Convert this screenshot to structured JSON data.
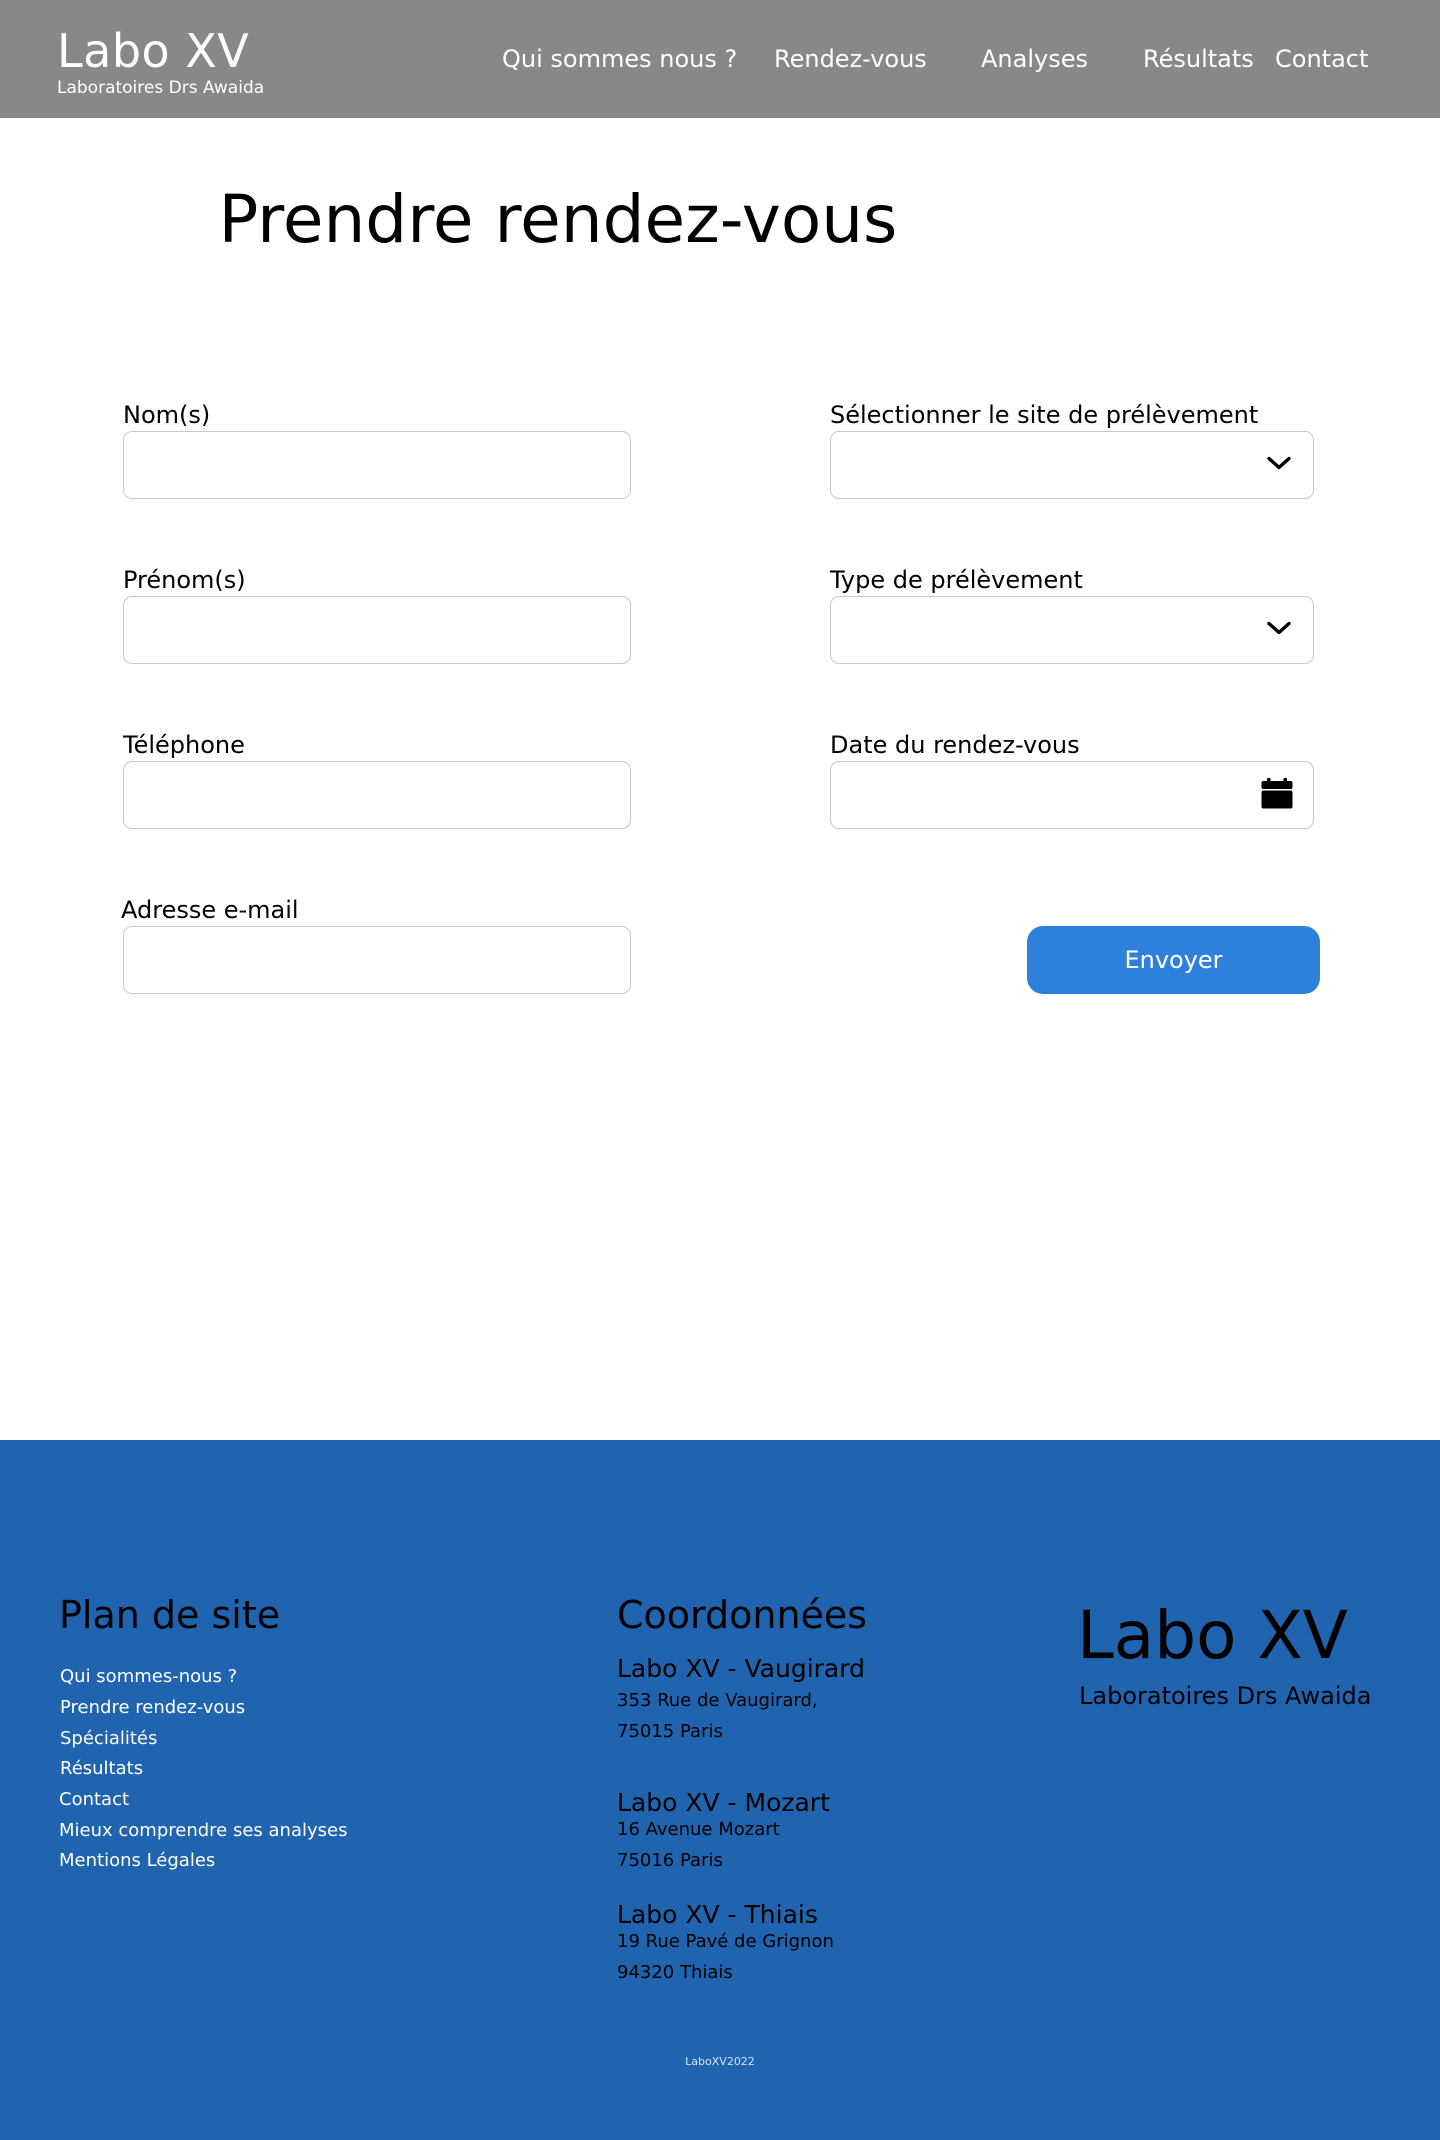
{
  "header": {
    "brand_title": "Labo XV",
    "brand_subtitle": "Laboratoires Drs Awaida",
    "nav": [
      {
        "label": "Qui sommes nous ?"
      },
      {
        "label": "Rendez-vous"
      },
      {
        "label": "Analyses"
      },
      {
        "label": "Résultats"
      },
      {
        "label": "Contact"
      }
    ],
    "background_color": "#888888"
  },
  "main": {
    "title": "Prendre rendez-vous",
    "form": {
      "last_name": {
        "label": "Nom(s)",
        "value": ""
      },
      "first_name": {
        "label": "Prénom(s)",
        "value": ""
      },
      "phone": {
        "label": "Téléphone",
        "value": ""
      },
      "email": {
        "label": "Adresse e-mail",
        "value": ""
      },
      "site": {
        "label": "Sélectionner le site de prélèvement",
        "value": "",
        "icon": "chevron-down-icon"
      },
      "type": {
        "label": "Type de prélèvement",
        "value": "",
        "icon": "chevron-down-icon"
      },
      "date": {
        "label": "Date du rendez-vous",
        "value": "",
        "icon": "calendar-icon"
      },
      "submit_label": "Envoyer",
      "submit_color": "#2f80dd"
    }
  },
  "footer": {
    "background_color": "#2063ae",
    "sitemap": {
      "heading": "Plan de site",
      "links": [
        "Qui sommes-nous ?",
        "Prendre rendez-vous",
        "Spécialités",
        "Résultats",
        "Contact",
        "Mieux comprendre ses analyses",
        "Mentions Légales"
      ]
    },
    "contact": {
      "heading": "Coordonnées",
      "sites": [
        {
          "name": "Labo XV - Vaugirard",
          "line1": "353 Rue de Vaugirard,",
          "line2": "75015 Paris"
        },
        {
          "name": "Labo XV - Mozart",
          "line1": "16 Avenue Mozart",
          "line2": "75016 Paris"
        },
        {
          "name": "Labo XV - Thiais",
          "line1": "19 Rue Pavé de Grignon",
          "line2": "94320 Thiais"
        }
      ]
    },
    "brand_title": "Labo XV",
    "brand_subtitle": "Laboratoires Drs Awaida",
    "copyright": "LaboXV2022"
  }
}
